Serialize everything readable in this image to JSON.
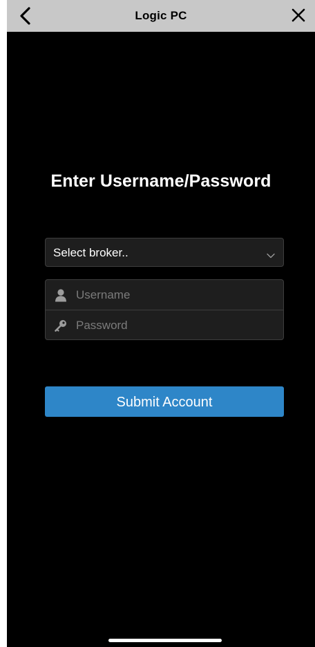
{
  "navbar": {
    "title": "Logic PC",
    "back_icon": "chevron-left-icon",
    "close_icon": "close-icon",
    "background": "#c8c8c8"
  },
  "form": {
    "heading": "Enter Username/Password",
    "broker_select": {
      "selected": "Select broker..",
      "icon": "chevron-down-icon"
    },
    "username": {
      "placeholder": "Username",
      "value": "",
      "icon": "user-icon"
    },
    "password": {
      "placeholder": "Password",
      "value": "",
      "icon": "key-icon"
    },
    "submit_label": "Submit Account"
  },
  "colors": {
    "background": "#000000",
    "field_background": "#1e1e1e",
    "field_border": "#3e3e3e",
    "accent": "#2e86c8",
    "placeholder": "#7b7b7b"
  }
}
